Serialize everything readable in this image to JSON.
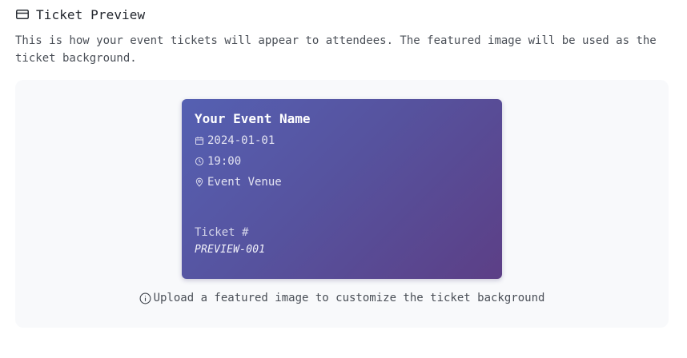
{
  "section": {
    "title": "Ticket Preview",
    "icon": "credit-card-icon",
    "description": "This is how your event tickets will appear to attendees. The featured image will be used as the ticket background."
  },
  "ticket": {
    "event_name": "Your Event Name",
    "date": "2024-01-01",
    "time": "19:00",
    "venue": "Event Venue",
    "number_label": "Ticket #",
    "number": "PREVIEW-001",
    "icons": [
      "calendar-icon",
      "clock-icon",
      "map-pin-icon"
    ],
    "gradient_colors": [
      "#5560b2",
      "#5c3f86"
    ]
  },
  "hint": {
    "icon": "info-icon",
    "text": "Upload a featured image to customize the ticket background"
  }
}
